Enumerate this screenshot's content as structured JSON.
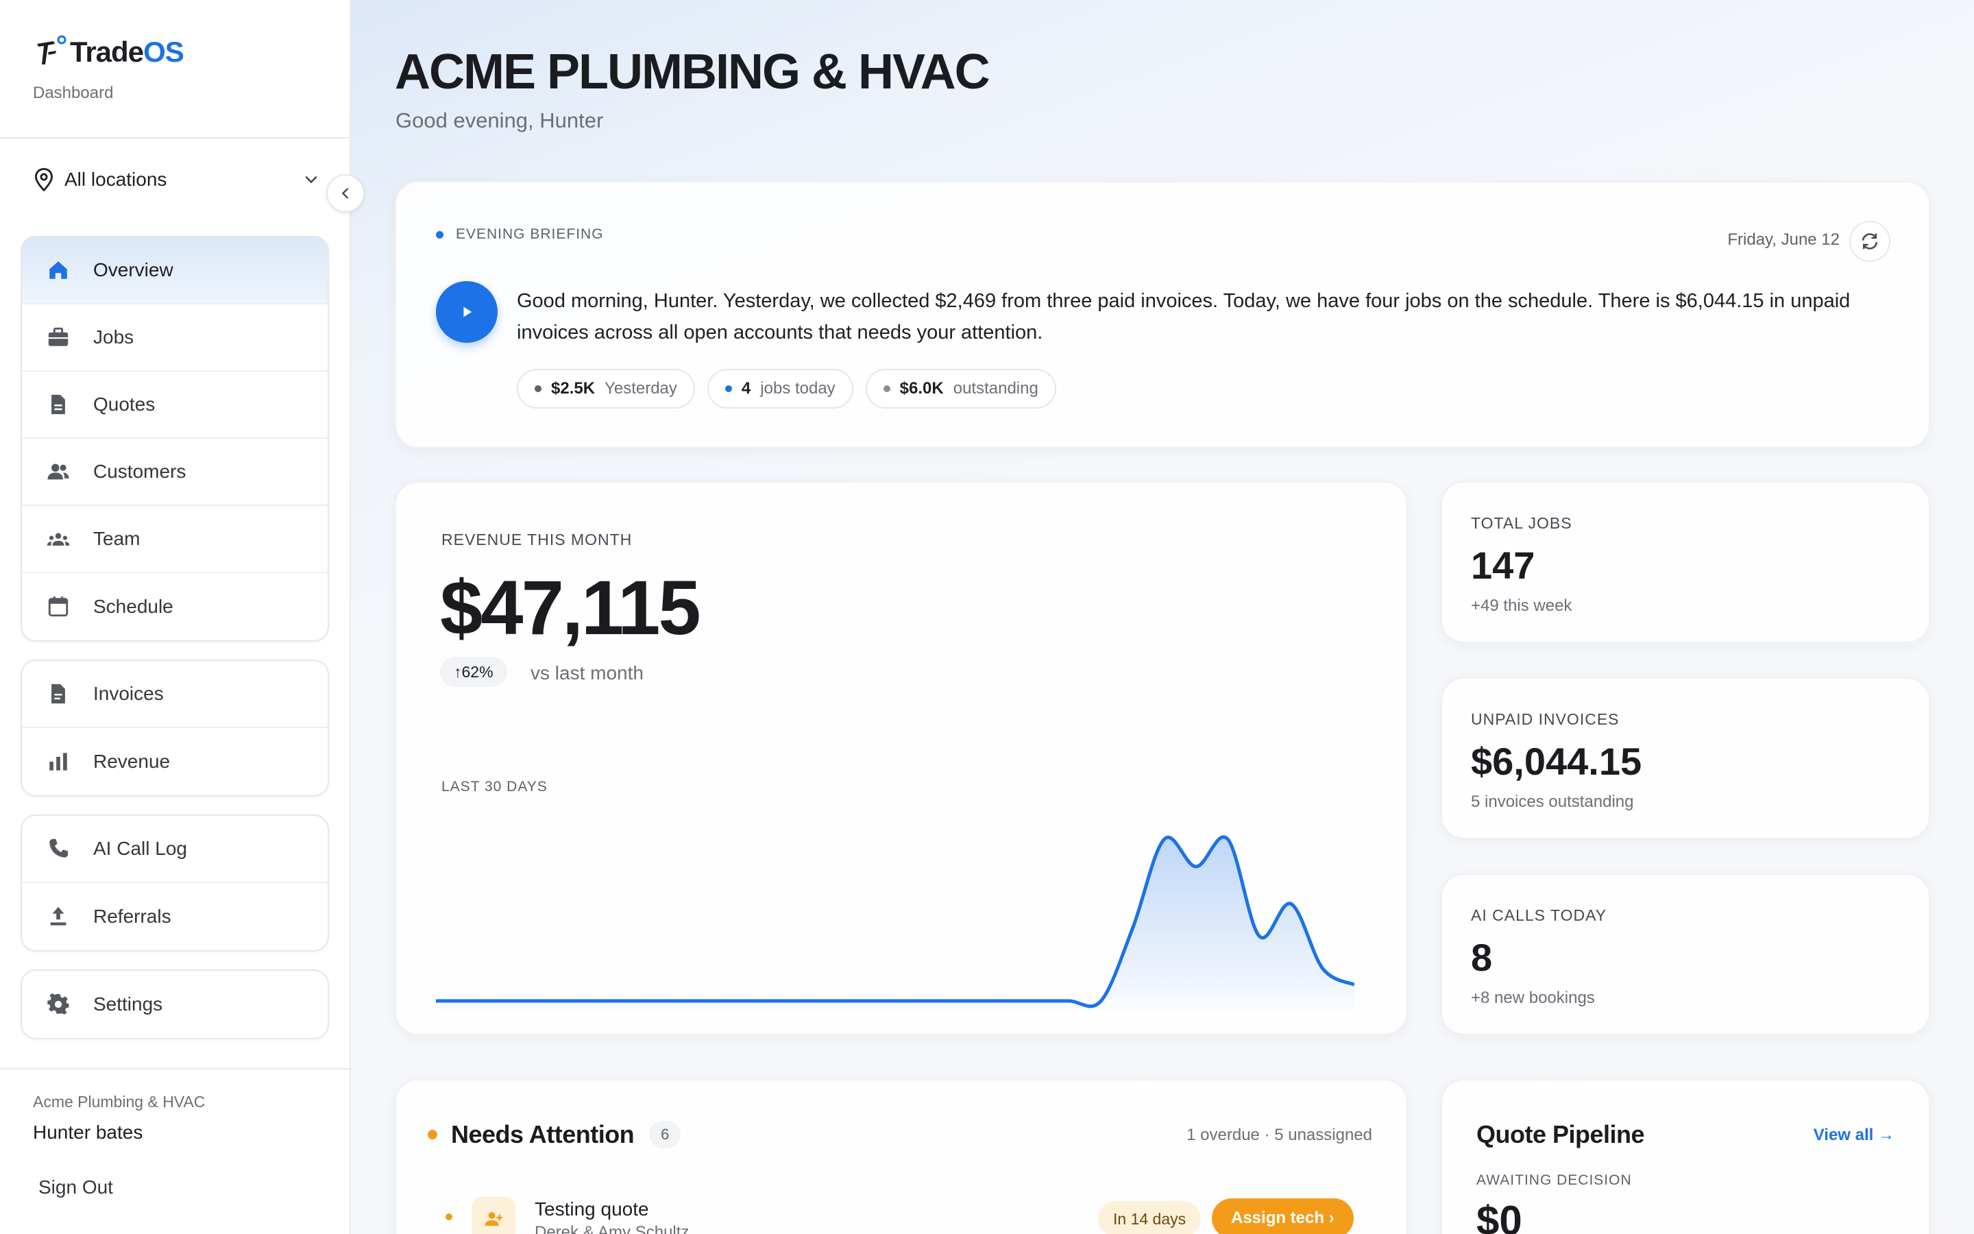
{
  "brand": {
    "name_part1": "Trade",
    "name_part2": "OS",
    "section": "Dashboard"
  },
  "location": {
    "label": "All locations"
  },
  "nav": {
    "group1": [
      {
        "label": "Overview",
        "icon": "home-icon",
        "active": true
      },
      {
        "label": "Jobs",
        "icon": "briefcase-icon"
      },
      {
        "label": "Quotes",
        "icon": "document-icon"
      },
      {
        "label": "Customers",
        "icon": "users-icon"
      },
      {
        "label": "Team",
        "icon": "team-icon"
      },
      {
        "label": "Schedule",
        "icon": "calendar-icon"
      }
    ],
    "group2": [
      {
        "label": "Invoices",
        "icon": "invoice-icon"
      },
      {
        "label": "Revenue",
        "icon": "bar-chart-icon"
      }
    ],
    "group3": [
      {
        "label": "AI Call Log",
        "icon": "phone-icon"
      },
      {
        "label": "Referrals",
        "icon": "upload-icon"
      }
    ],
    "group4": [
      {
        "label": "Settings",
        "icon": "gear-icon"
      }
    ]
  },
  "user": {
    "company": "Acme Plumbing & HVAC",
    "name": "Hunter bates",
    "signout": "Sign Out"
  },
  "header": {
    "title": "ACME PLUMBING & HVAC",
    "greeting": "Good evening, Hunter"
  },
  "briefing": {
    "tag": "EVENING BRIEFING",
    "date": "Friday, June 12",
    "text": "Good morning, Hunter. Yesterday, we collected $2,469 from three paid invoices. Today, we have four jobs on the schedule. There is $6,044.15 in unpaid invoices across all open accounts that needs your attention.",
    "chips": [
      {
        "value": "$2.5K",
        "label": "Yesterday",
        "color": "#5d6168"
      },
      {
        "value": "4",
        "label": "jobs today",
        "color": "#1c72e6"
      },
      {
        "value": "$6.0K",
        "label": "outstanding",
        "color": "#8a8e94"
      }
    ]
  },
  "revenue": {
    "label": "REVENUE THIS MONTH",
    "value": "$47,115",
    "change": "↑62%",
    "change_label": "vs last month",
    "chart_label": "LAST 30 DAYS"
  },
  "stats": [
    {
      "label": "TOTAL JOBS",
      "value": "147",
      "sub": "+49 this week"
    },
    {
      "label": "UNPAID INVOICES",
      "value": "$6,044.15",
      "sub": "5 invoices outstanding"
    },
    {
      "label": "AI CALLS TODAY",
      "value": "8",
      "sub": "+8 new bookings"
    }
  ],
  "attention": {
    "title": "Needs Attention",
    "count": "6",
    "meta": "1 overdue · 5 unassigned",
    "rows": [
      {
        "title": "Testing quote",
        "subtitle": "Derek & Amy Schultz",
        "due": "In 14 days",
        "action": "Assign tech ›"
      }
    ]
  },
  "pipeline": {
    "title": "Quote Pipeline",
    "link": "View all →",
    "label": "AWAITING DECISION",
    "value": "$0"
  },
  "chart_data": {
    "type": "area",
    "title": "LAST 30 DAYS",
    "x": [
      1,
      2,
      3,
      4,
      5,
      6,
      7,
      8,
      9,
      10,
      11,
      12,
      13,
      14,
      15,
      16,
      17,
      18,
      19,
      20,
      21,
      22,
      23,
      24,
      25,
      26,
      27,
      28,
      29,
      30
    ],
    "values": [
      0,
      0,
      0,
      0,
      0,
      0,
      0,
      0,
      0,
      0,
      0,
      0,
      0,
      0,
      0,
      0,
      0,
      0,
      0,
      0,
      0,
      0,
      0.45,
      1.0,
      0.83,
      1.0,
      0.4,
      0.6,
      0.2,
      0.1
    ],
    "grid": false,
    "color": "#1c72e6"
  },
  "colors": {
    "accent": "#1c72e6",
    "warning": "#f39c1a"
  }
}
